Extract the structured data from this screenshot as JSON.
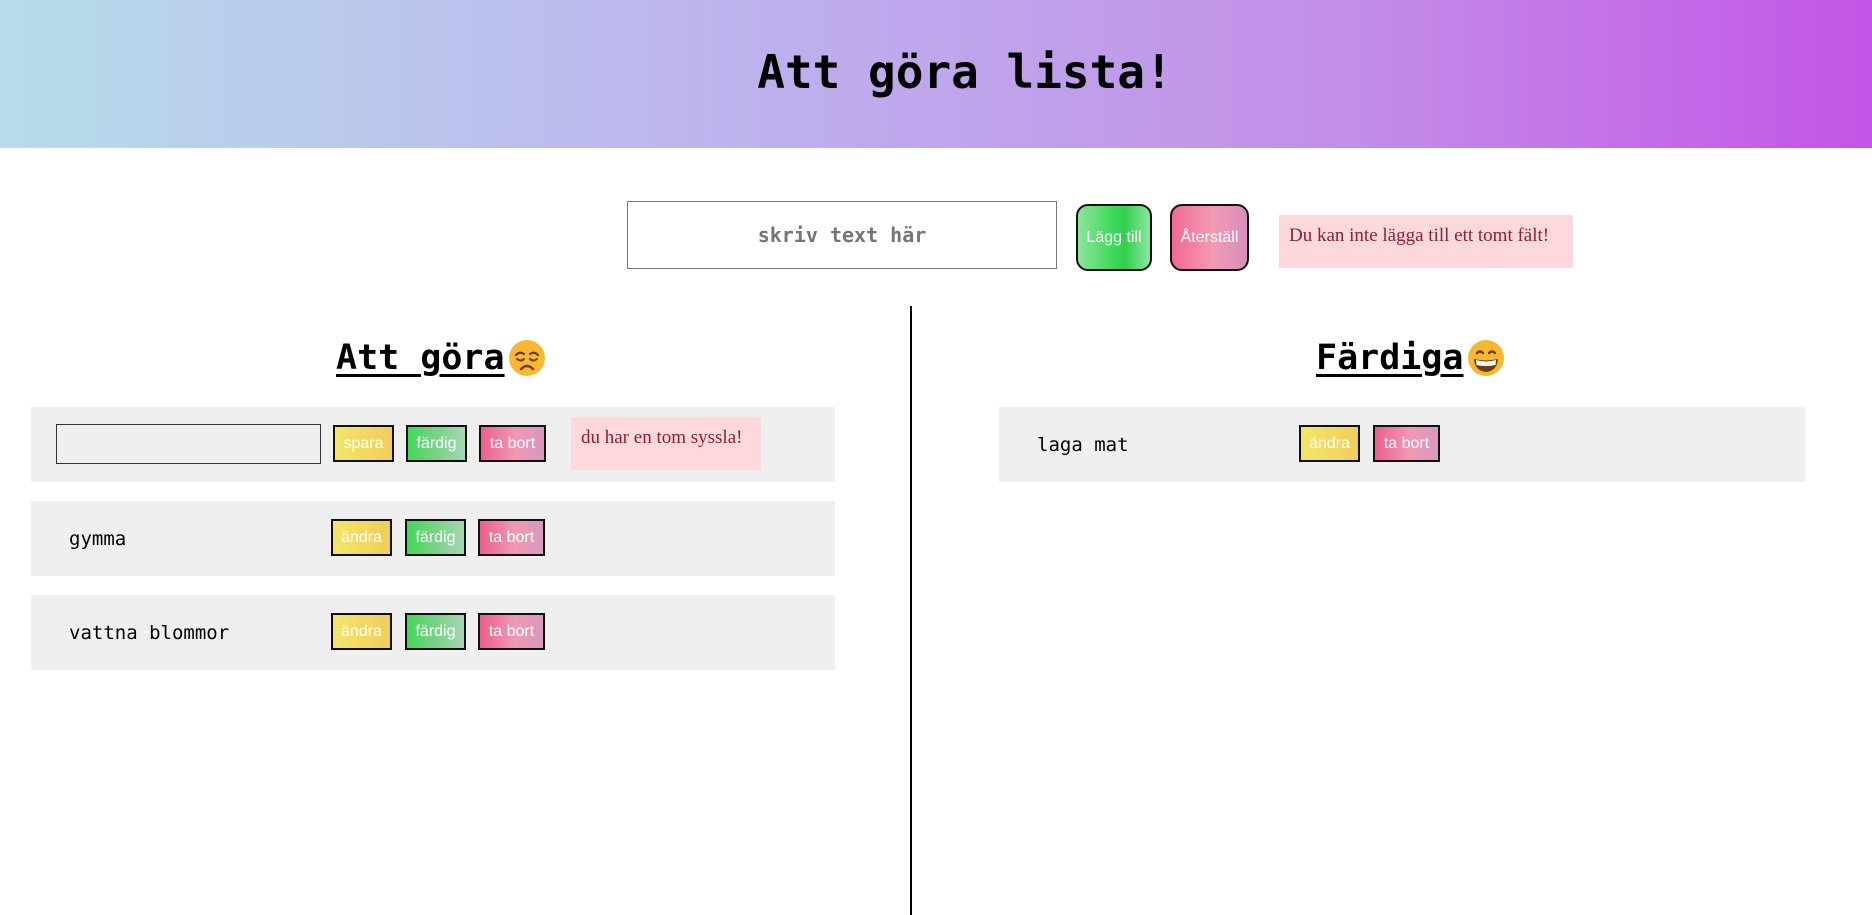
{
  "header": {
    "title": "Att göra lista!"
  },
  "form": {
    "input_placeholder": "skriv text här",
    "add_label": "Lägg till",
    "reset_label": "Återställ",
    "error": "Du kan inte lägga till ett tomt fält!"
  },
  "todo": {
    "title": "Att göra",
    "emoji": "weary-face-icon",
    "editing_item": {
      "value": "",
      "save_label": "spara",
      "done_label": "färdig",
      "delete_label": "ta bort",
      "error": "du har en tom syssla!"
    },
    "items": [
      {
        "text": "gymma",
        "edit_label": "ändra",
        "done_label": "färdig",
        "delete_label": "ta bort"
      },
      {
        "text": "vattna blommor",
        "edit_label": "ändra",
        "done_label": "färdig",
        "delete_label": "ta bort"
      }
    ]
  },
  "done": {
    "title": "Färdiga",
    "emoji": "grinning-face-icon",
    "items": [
      {
        "text": "laga mat",
        "edit_label": "ändra",
        "delete_label": "ta bort"
      }
    ]
  },
  "colors": {
    "header_gradient": [
      "#b6dcea",
      "#bdb7ee",
      "#c38ee8",
      "#c355e7"
    ],
    "row_bg": "#efefef",
    "error_bg": "#fdd9dd",
    "error_text": "#8c2230",
    "add_green": "#3bd95a",
    "reset_pink": "#f06a92",
    "edit_yellow": "#f2d860"
  }
}
